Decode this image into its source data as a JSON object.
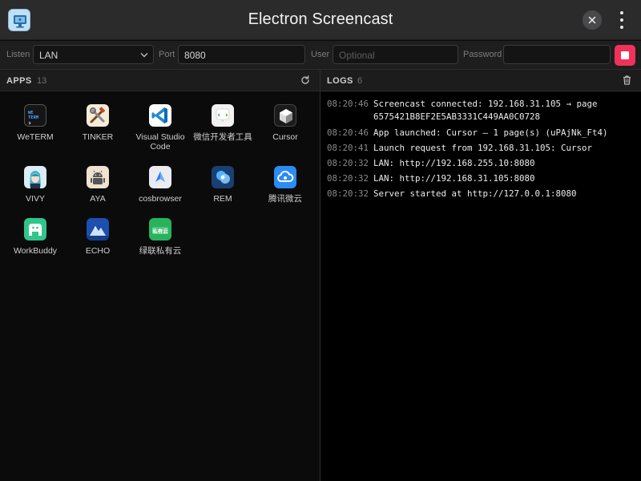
{
  "window": {
    "title": "Electron Screencast"
  },
  "settings": {
    "listen_label": "Listen",
    "listen_value": "LAN",
    "port_label": "Port",
    "port_value": "8080",
    "user_label": "User",
    "user_placeholder": "Optional",
    "password_label": "Password",
    "password_value": ""
  },
  "apps": {
    "title": "APPS",
    "count": "13",
    "items": [
      {
        "name": "WeTERM",
        "icon": "weterm-icon"
      },
      {
        "name": "TINKER",
        "icon": "tinker-icon"
      },
      {
        "name": "Visual Studio Code",
        "icon": "vscode-icon"
      },
      {
        "name": "微信开发者工具",
        "icon": "wechat-devtools-icon"
      },
      {
        "name": "Cursor",
        "icon": "cursor-icon"
      },
      {
        "name": "VIVY",
        "icon": "vivy-icon"
      },
      {
        "name": "AYA",
        "icon": "aya-android-icon"
      },
      {
        "name": "cosbrowser",
        "icon": "cosbrowser-icon"
      },
      {
        "name": "REM",
        "icon": "rem-icon"
      },
      {
        "name": "腾讯微云",
        "icon": "tencent-weiyun-icon"
      },
      {
        "name": "WorkBuddy",
        "icon": "workbuddy-icon"
      },
      {
        "name": "ECHO",
        "icon": "echo-icon"
      },
      {
        "name": "绿联私有云",
        "icon": "ugreen-cloud-icon"
      }
    ],
    "weterm_icon_text": "WE TERM",
    "ugreen_icon_text": "私有云"
  },
  "logs": {
    "title": "LOGS",
    "count": "6",
    "entries": [
      {
        "time": "08:20:46",
        "msg": "Screencast connected: 192.168.31.105 → page 6575421B8EF2E5AB3331C449AA0C0728"
      },
      {
        "time": "08:20:46",
        "msg": "App launched: Cursor — 1 page(s) (uPAjNk_Ft4)"
      },
      {
        "time": "08:20:41",
        "msg": "Launch request from 192.168.31.105: Cursor"
      },
      {
        "time": "08:20:32",
        "msg": "LAN: http://192.168.255.10:8080"
      },
      {
        "time": "08:20:32",
        "msg": "LAN: http://192.168.31.105:8080"
      },
      {
        "time": "08:20:32",
        "msg": "Server started at http://127.0.0.1:8080"
      }
    ]
  },
  "colors": {
    "accent_stop": "#f0325a",
    "background": "#0b0b0b",
    "panel": "#1c1c1d"
  }
}
